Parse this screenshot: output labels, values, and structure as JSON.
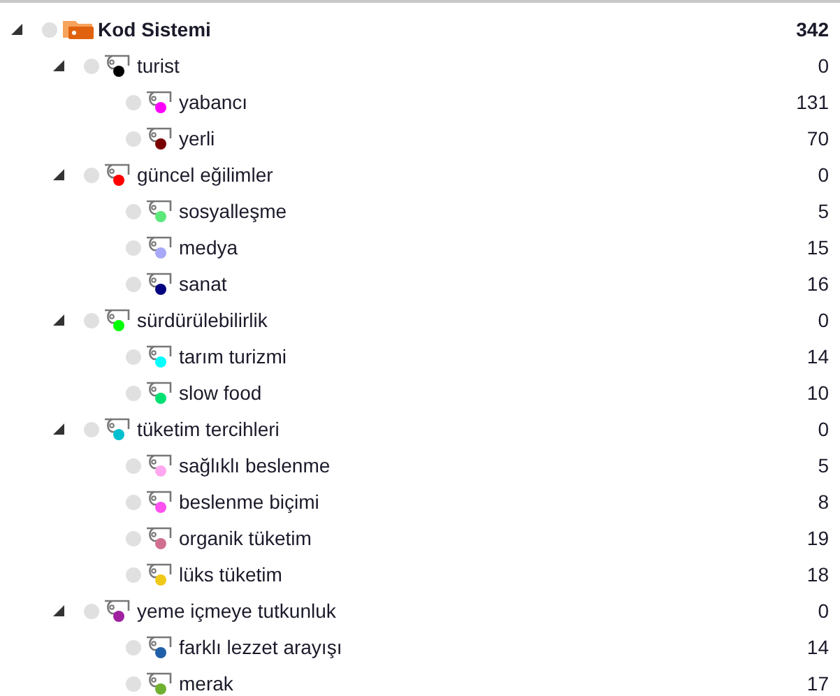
{
  "code_system": {
    "label": "Kod Sistemi",
    "count": "342",
    "expanded": true,
    "children": [
      {
        "label": "turist",
        "count": "0",
        "color": "#000000",
        "expanded": true,
        "children": [
          {
            "label": "yabancı",
            "count": "131",
            "color": "#ff00ff"
          },
          {
            "label": "yerli",
            "count": "70",
            "color": "#7a0000"
          }
        ]
      },
      {
        "label": "güncel eğilimler",
        "count": "0",
        "color": "#ff0000",
        "expanded": true,
        "children": [
          {
            "label": "sosyalleşme",
            "count": "5",
            "color": "#5ce87a"
          },
          {
            "label": "medya",
            "count": "15",
            "color": "#a8a8f8"
          },
          {
            "label": "sanat",
            "count": "16",
            "color": "#000080"
          }
        ]
      },
      {
        "label": "sürdürülebilirlik",
        "count": "0",
        "color": "#00ff00",
        "expanded": true,
        "children": [
          {
            "label": "tarım turizmi",
            "count": "14",
            "color": "#00ffff"
          },
          {
            "label": "slow food",
            "count": "10",
            "color": "#00e070"
          }
        ]
      },
      {
        "label": "tüketim tercihleri",
        "count": "0",
        "color": "#00c0d0",
        "expanded": true,
        "children": [
          {
            "label": "sağlıklı beslenme",
            "count": "5",
            "color": "#ffa8f0"
          },
          {
            "label": "beslenme biçimi",
            "count": "8",
            "color": "#ff50f0"
          },
          {
            "label": "organik tüketim",
            "count": "19",
            "color": "#d07090"
          },
          {
            "label": "lüks tüketim",
            "count": "18",
            "color": "#f0c818"
          }
        ]
      },
      {
        "label": "yeme içmeye tutkunluk",
        "count": "0",
        "color": "#a020a0",
        "expanded": true,
        "children": [
          {
            "label": "farklı lezzet arayışı",
            "count": "14",
            "color": "#2060a8"
          },
          {
            "label": "merak",
            "count": "17",
            "color": "#70b030"
          }
        ]
      }
    ]
  }
}
